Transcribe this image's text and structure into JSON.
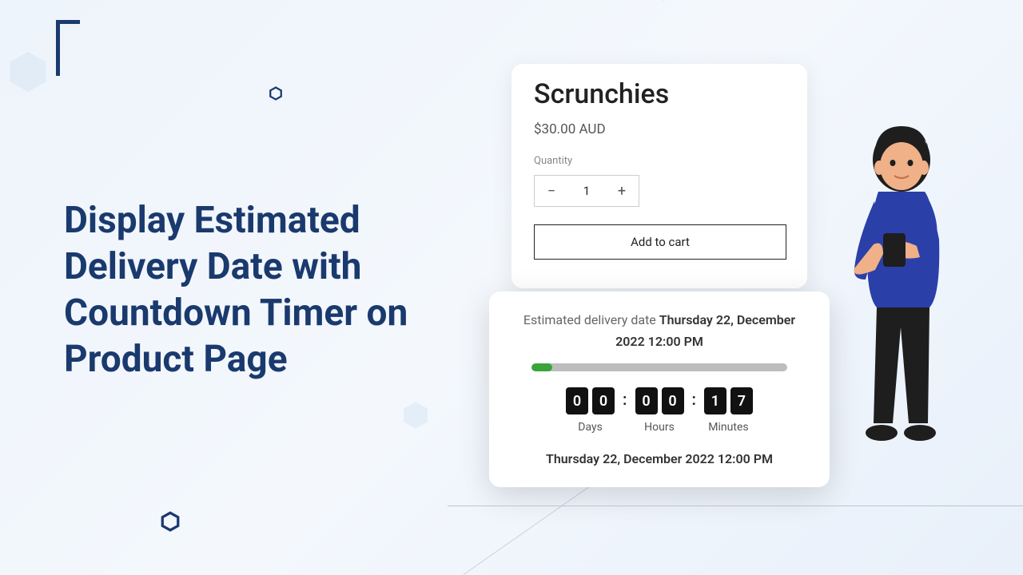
{
  "headline": "Display Estimated Delivery Date with Countdown Timer on Product Page",
  "product": {
    "title": "Scrunchies",
    "price": "$30.00 AUD",
    "quantity_label": "Quantity",
    "quantity_value": "1",
    "add_to_cart": "Add to cart"
  },
  "countdown": {
    "estimated_prefix": "Estimated delivery date ",
    "estimated_date": "Thursday 22, December 2022 12:00 PM",
    "progress_percent": 8,
    "days": [
      "0",
      "0"
    ],
    "hours": [
      "0",
      "0"
    ],
    "minutes": [
      "1",
      "7"
    ],
    "labels": {
      "days": "Days",
      "hours": "Hours",
      "minutes": "Minutes"
    },
    "final_date": "Thursday 22, December 2022 12:00 PM"
  },
  "colors": {
    "headline": "#1a3a6e",
    "progress_fill": "#39a43a"
  }
}
